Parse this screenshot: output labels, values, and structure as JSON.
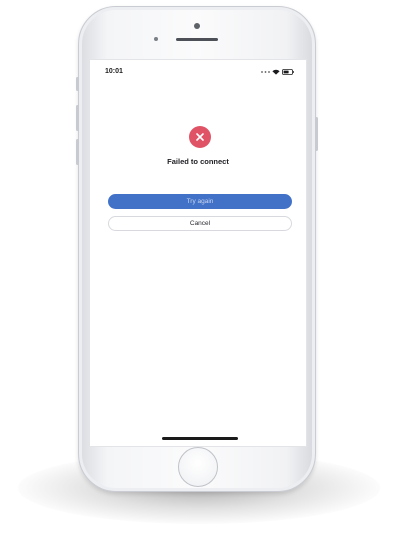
{
  "status_bar": {
    "time": "10:01",
    "signal_icon": "signal-dots-icon",
    "wifi_icon": "wifi-icon",
    "battery_icon": "battery-icon"
  },
  "dialog": {
    "icon": "error-x-icon",
    "icon_color": "#e05367",
    "title": "Failed to connect",
    "primary_button": "Try again",
    "primary_color": "#4272c8",
    "secondary_button": "Cancel"
  }
}
